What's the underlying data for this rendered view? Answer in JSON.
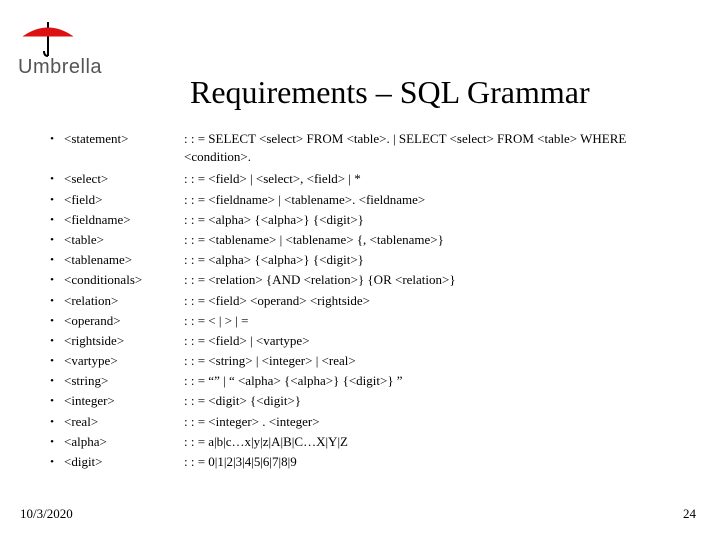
{
  "logo_text": "Umbrella",
  "title": "Requirements – SQL Grammar",
  "rules": [
    {
      "term": "<statement>",
      "def": ": : = SELECT <select> FROM <table>. | SELECT <select> FROM <table> WHERE <condition>."
    },
    {
      "term": "<select>",
      "def": ": : = <field> | <select>, <field> | *"
    },
    {
      "term": "<field>",
      "def": ": : = <fieldname> | <tablename>. <fieldname>"
    },
    {
      "term": "<fieldname>",
      "def": ": : = <alpha> {<alpha>} {<digit>}"
    },
    {
      "term": "<table>",
      "def": ": : = <tablename> | <tablename> {, <tablename>}"
    },
    {
      "term": "<tablename>",
      "def": ": : = <alpha> {<alpha>} {<digit>}"
    },
    {
      "term": "<conditionals>",
      "def": ": : = <relation> {AND <relation>} {OR <relation>}"
    },
    {
      "term": "<relation>",
      "def": ": : = <field> <operand> <rightside>"
    },
    {
      "term": "<operand>",
      "def": ": : = < | > | ="
    },
    {
      "term": "<rightside>",
      "def": ": : = <field> | <vartype>"
    },
    {
      "term": "<vartype>",
      "def": ": : = <string> | <integer> | <real>"
    },
    {
      "term": "<string>",
      "def": ": : = “” | “ <alpha> {<alpha>} {<digit>} ”"
    },
    {
      "term": "<integer>",
      "def": ": : = <digit> {<digit>}"
    },
    {
      "term": "<real>",
      "def": ": : = <integer> . <integer>"
    },
    {
      "term": "<alpha>",
      "def": ": : = a|b|c…x|y|z|A|B|C…X|Y|Z"
    },
    {
      "term": "<digit>",
      "def": ": : = 0|1|2|3|4|5|6|7|8|9"
    }
  ],
  "footer_date": "10/3/2020",
  "footer_page": "24"
}
